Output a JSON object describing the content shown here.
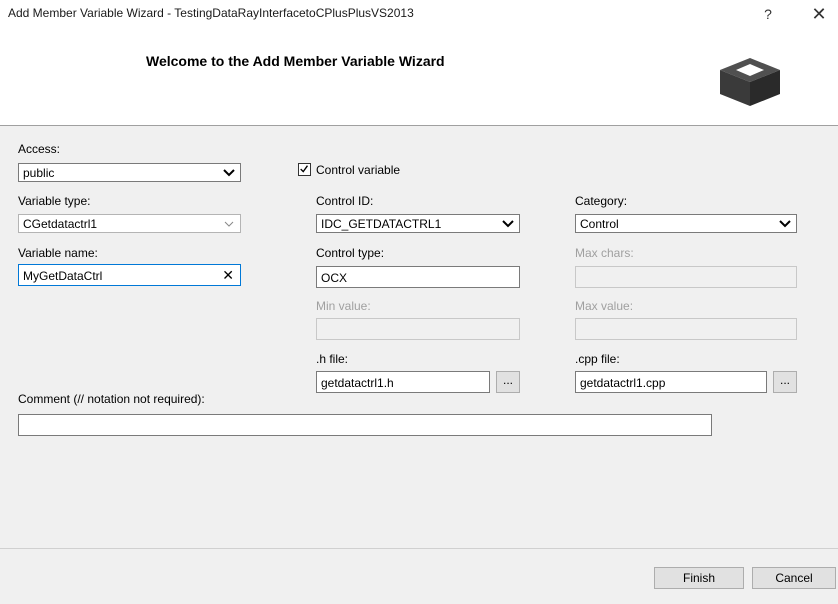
{
  "window": {
    "title": "Add Member Variable Wizard - TestingDataRayInterfacetoCPlusPlusVS2013",
    "help_label": "?",
    "close_label": "✕"
  },
  "header": {
    "heading": "Welcome to the Add Member Variable Wizard"
  },
  "access": {
    "label": "Access:",
    "value": "public"
  },
  "control_variable": {
    "label": "Control variable",
    "checked": true
  },
  "variable_type": {
    "label": "Variable type:",
    "value": "CGetdatactrl1"
  },
  "variable_name": {
    "label": "Variable name:",
    "value": "MyGetDataCtrl",
    "clear_label": "✕"
  },
  "control_id": {
    "label": "Control ID:",
    "value": "IDC_GETDATACTRL1"
  },
  "category": {
    "label": "Category:",
    "value": "Control"
  },
  "control_type": {
    "label": "Control type:",
    "value": "OCX"
  },
  "max_chars": {
    "label": "Max chars:",
    "value": ""
  },
  "min_value": {
    "label": "Min value:",
    "value": ""
  },
  "max_value": {
    "label": "Max value:",
    "value": ""
  },
  "h_file": {
    "label": ".h file:",
    "value": "getdatactrl1.h",
    "browse_label": "..."
  },
  "cpp_file": {
    "label": ".cpp file:",
    "value": "getdatactrl1.cpp",
    "browse_label": "..."
  },
  "comment": {
    "label": "Comment (// notation not required):",
    "value": ""
  },
  "footer": {
    "finish_label": "Finish",
    "cancel_label": "Cancel"
  }
}
